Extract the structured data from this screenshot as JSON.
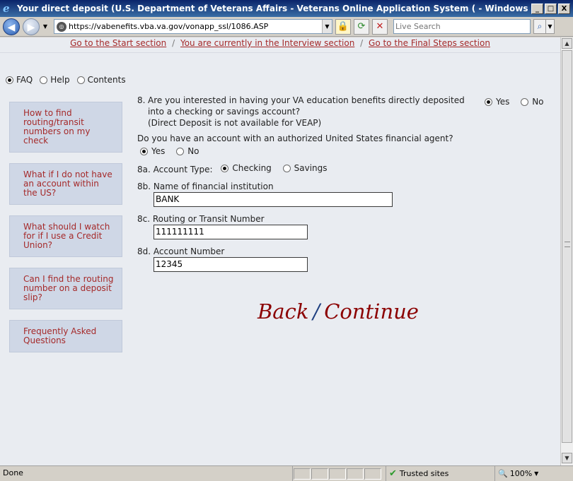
{
  "window": {
    "title": "Your direct deposit (U.S. Department of Veterans Affairs - Veterans Online Application System ( - Windows Internet Explorer",
    "minimize": "_",
    "maximize": "□",
    "close": "X"
  },
  "address": {
    "url": "https://vabenefits.vba.va.gov/vonapp_ssl/1086.ASP",
    "search_placeholder": "Live Search"
  },
  "section_nav": {
    "start": "Go to the Start section",
    "interview": "You are currently in the Interview section",
    "final": "Go to the Final Steps section",
    "sep": "/"
  },
  "side_tabs": [
    {
      "label": "FAQ",
      "selected": true
    },
    {
      "label": "Help",
      "selected": false
    },
    {
      "label": "Contents",
      "selected": false
    }
  ],
  "help_links": [
    "How to find routing/transit numbers on my check",
    "What if I do not have an account within the US?",
    "What should I watch for if I use a Credit Union?",
    "Can I find the routing number on a deposit slip?",
    "Frequently Asked Questions"
  ],
  "form": {
    "q8_num": "8.",
    "q8_text": "Are you interested in having your VA education benefits directly deposited into a checking or savings account?",
    "q8_note": "(Direct Deposit is not available for VEAP)",
    "q8_yes": "Yes",
    "q8_no": "No",
    "q_account": "Do you have an account with an authorized United States financial agent?",
    "q_account_yes": "Yes",
    "q_account_no": "No",
    "q8a_label": "8a. Account Type:",
    "q8a_checking": "Checking",
    "q8a_savings": "Savings",
    "q8b_label": "8b. Name of financial institution",
    "q8b_value": "BANK",
    "q8c_label": "8c. Routing or Transit Number",
    "q8c_value": "111111111",
    "q8d_label": "8d. Account Number",
    "q8d_value": "12345"
  },
  "nav": {
    "back": "Back",
    "slash": "/",
    "continue": "Continue"
  },
  "status": {
    "text": "Done",
    "zone": "Trusted sites",
    "zoom": "100%"
  }
}
